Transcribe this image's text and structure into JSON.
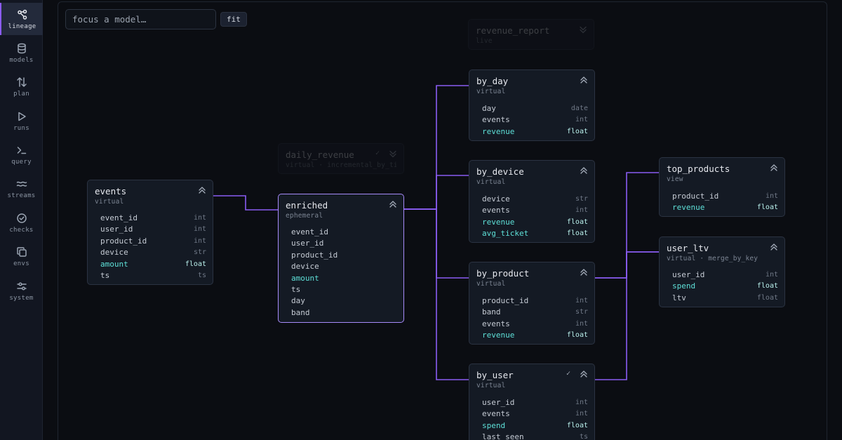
{
  "sidebar": {
    "items": [
      {
        "label": "lineage",
        "icon": "lineage-icon"
      },
      {
        "label": "models",
        "icon": "database-icon"
      },
      {
        "label": "plan",
        "icon": "arrows-up-down-icon"
      },
      {
        "label": "runs",
        "icon": "play-icon"
      },
      {
        "label": "query",
        "icon": "terminal-icon"
      },
      {
        "label": "streams",
        "icon": "waves-icon"
      },
      {
        "label": "checks",
        "icon": "check-circle-icon"
      },
      {
        "label": "envs",
        "icon": "copy-icon"
      },
      {
        "label": "system",
        "icon": "sliders-icon"
      }
    ],
    "active": "lineage"
  },
  "toolbar": {
    "search_placeholder": "focus a model…",
    "fit_label": "fit"
  },
  "graph": {
    "edge_color": "#8a5cf2",
    "selected_node": "enriched",
    "nodes": {
      "revenue_report": {
        "name": "revenue_report",
        "kind": "live",
        "dimmed": true,
        "columns": []
      },
      "daily_revenue": {
        "name": "daily_revenue",
        "kind": "virtual · incremental_by_time",
        "dimmed": true,
        "checked": true,
        "check_mark": "✓",
        "columns": []
      },
      "events": {
        "name": "events",
        "kind": "virtual",
        "columns": [
          {
            "name": "event_id",
            "type": "int"
          },
          {
            "name": "user_id",
            "type": "int"
          },
          {
            "name": "product_id",
            "type": "int"
          },
          {
            "name": "device",
            "type": "str"
          },
          {
            "name": "amount",
            "type": "float",
            "metric": true
          },
          {
            "name": "ts",
            "type": "ts"
          }
        ]
      },
      "enriched": {
        "name": "enriched",
        "kind": "ephemeral",
        "columns": [
          {
            "name": "event_id",
            "type": ""
          },
          {
            "name": "user_id",
            "type": ""
          },
          {
            "name": "product_id",
            "type": ""
          },
          {
            "name": "device",
            "type": ""
          },
          {
            "name": "amount",
            "type": "",
            "metric": true
          },
          {
            "name": "ts",
            "type": ""
          },
          {
            "name": "day",
            "type": ""
          },
          {
            "name": "band",
            "type": ""
          }
        ]
      },
      "by_day": {
        "name": "by_day",
        "kind": "virtual",
        "columns": [
          {
            "name": "day",
            "type": "date"
          },
          {
            "name": "events",
            "type": "int"
          },
          {
            "name": "revenue",
            "type": "float",
            "metric": true
          }
        ]
      },
      "by_device": {
        "name": "by_device",
        "kind": "virtual",
        "columns": [
          {
            "name": "device",
            "type": "str"
          },
          {
            "name": "events",
            "type": "int"
          },
          {
            "name": "revenue",
            "type": "float",
            "metric": true
          },
          {
            "name": "avg_ticket",
            "type": "float",
            "metric": true
          }
        ]
      },
      "by_product": {
        "name": "by_product",
        "kind": "virtual",
        "columns": [
          {
            "name": "product_id",
            "type": "int"
          },
          {
            "name": "band",
            "type": "str"
          },
          {
            "name": "events",
            "type": "int"
          },
          {
            "name": "revenue",
            "type": "float",
            "metric": true
          }
        ]
      },
      "by_user": {
        "name": "by_user",
        "kind": "virtual",
        "checked": true,
        "check_mark": "✓",
        "columns": [
          {
            "name": "user_id",
            "type": "int"
          },
          {
            "name": "events",
            "type": "int"
          },
          {
            "name": "spend",
            "type": "float",
            "metric": true
          },
          {
            "name": "last_seen",
            "type": "ts"
          }
        ]
      },
      "top_products": {
        "name": "top_products",
        "kind": "view",
        "columns": [
          {
            "name": "product_id",
            "type": "int"
          },
          {
            "name": "revenue",
            "type": "float",
            "metric": true
          }
        ]
      },
      "user_ltv": {
        "name": "user_ltv",
        "kind": "virtual · merge_by_key",
        "columns": [
          {
            "name": "user_id",
            "type": "int"
          },
          {
            "name": "spend",
            "type": "float",
            "metric": true
          },
          {
            "name": "ltv",
            "type": "float"
          }
        ]
      }
    }
  }
}
